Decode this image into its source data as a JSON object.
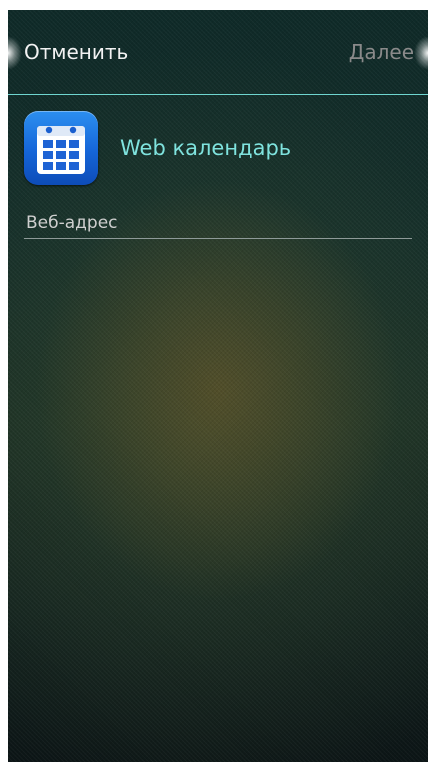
{
  "header": {
    "cancel_label": "Отменить",
    "next_label": "Далее",
    "divider_color": "#6fd6d0"
  },
  "account": {
    "icon": "calendar-icon",
    "title": "Web календарь",
    "title_color": "#7fe3de"
  },
  "form": {
    "url_placeholder": "Веб-адрес",
    "url_value": ""
  }
}
